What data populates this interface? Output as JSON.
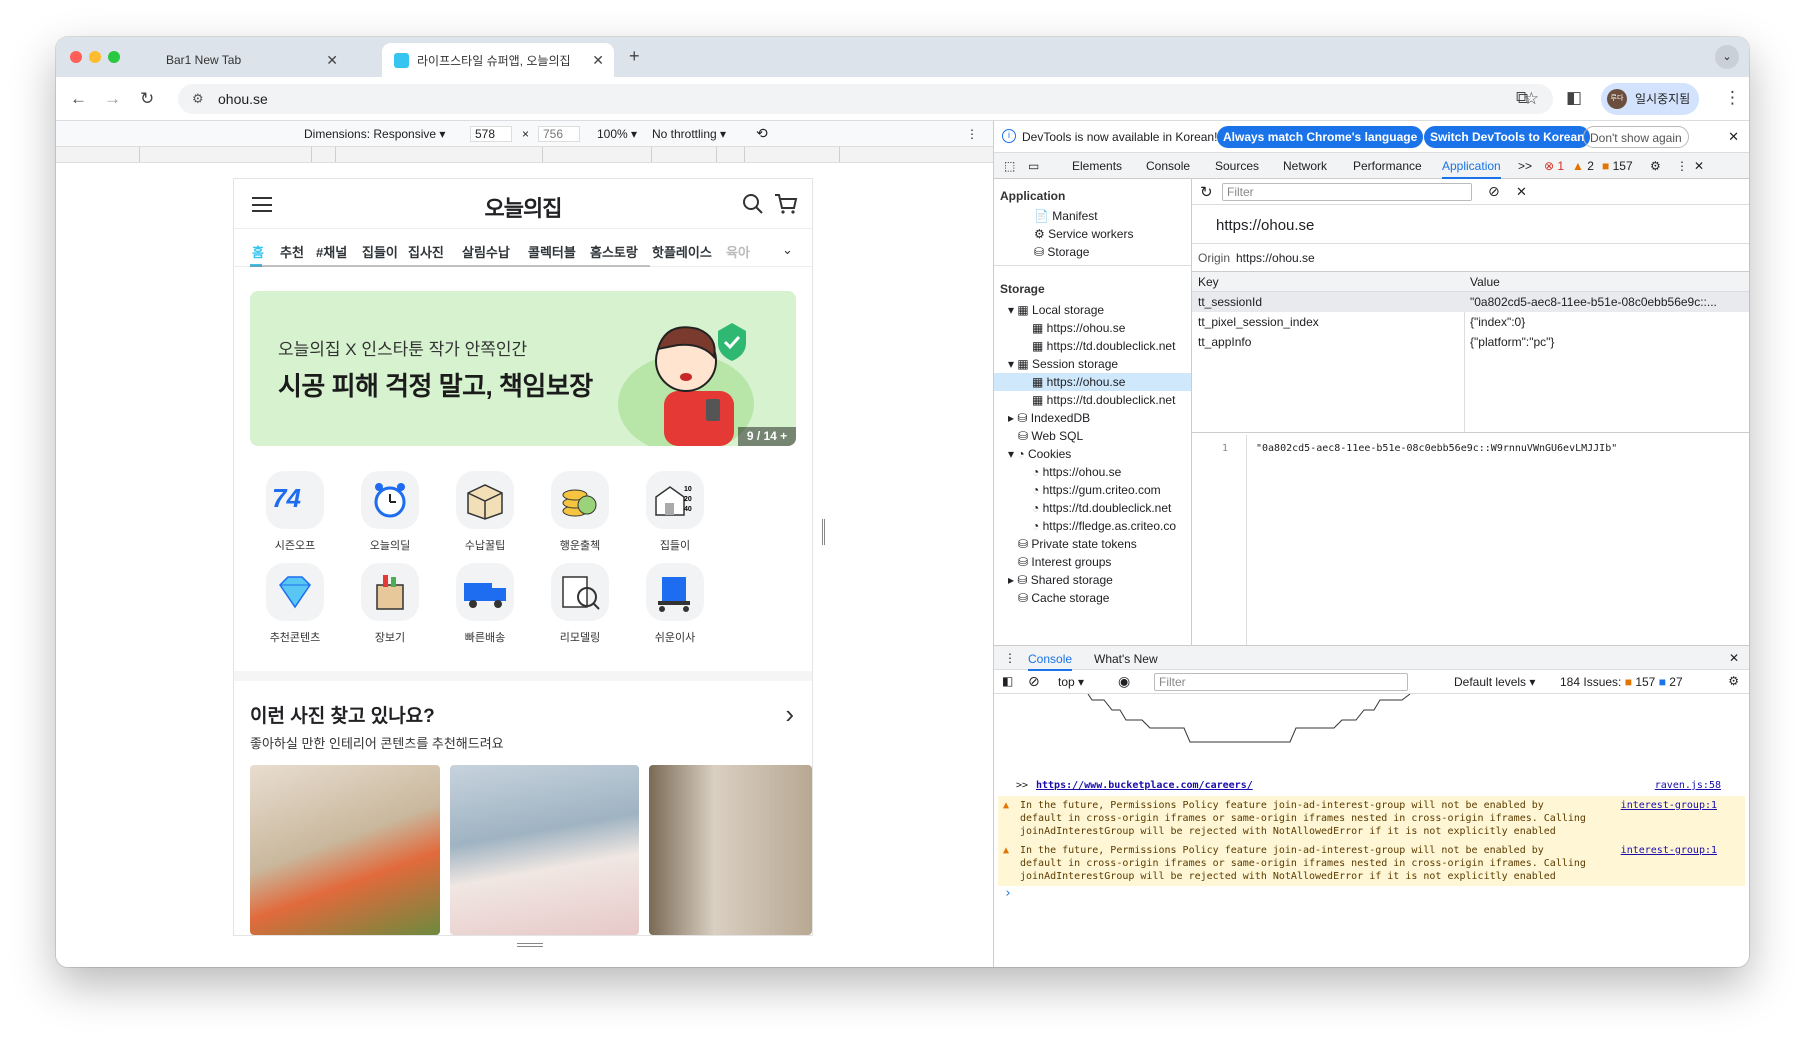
{
  "browser": {
    "tabs": [
      {
        "label": "Bar1 New Tab",
        "active": false
      },
      {
        "label": "라이프스타일 슈퍼앱, 오늘의집",
        "active": true
      }
    ],
    "new_tab": "+",
    "close_glyph": "✕",
    "url": "ohou.se",
    "profile_name": "일시중지됨",
    "profile_initials": "루다"
  },
  "device_toolbar": {
    "dimensions_label": "Dimensions: Responsive",
    "width": "578",
    "times": "×",
    "height": "756",
    "zoom": "100%",
    "throttle": "No throttling"
  },
  "site": {
    "logo": "오늘의집",
    "categories": [
      "홈",
      "추천",
      "#채널",
      "집들이",
      "집사진",
      "살림수납",
      "콜렉터블",
      "홈스토랑",
      "핫플레이스",
      "육아"
    ],
    "banner": {
      "line1": "오늘의집 X 인스타툰 작가 안쪽인간",
      "line2": "시공 피해 걱정 말고, 책임보장",
      "pager": "9 / 14 +"
    },
    "shortcut_badge": "74",
    "shortcut_ticks": [
      "10",
      "20",
      "40"
    ],
    "shortcuts": [
      "시즌오프",
      "오늘의딜",
      "수납꿀팁",
      "행운출첵",
      "집들이",
      "추천콘텐츠",
      "장보기",
      "빠른배송",
      "리모델링",
      "쉬운이사"
    ],
    "section_title": "이런 사진 찾고 있나요?",
    "section_sub": "좋아하실 만한 인테리어 콘텐츠를 추천해드려요"
  },
  "devtools": {
    "info": "DevTools is now available in Korean!",
    "btn_match": "Always match Chrome's language",
    "btn_switch": "Switch DevTools to Korean",
    "btn_dont": "Don't show again",
    "tabs": [
      "Elements",
      "Console",
      "Sources",
      "Network",
      "Performance",
      "Application"
    ],
    "more_tabs": ">>",
    "errors": "1",
    "warnings": "2",
    "issues": "157",
    "filter_placeholder": "Filter",
    "app_section": "Application",
    "app_items": [
      "Manifest",
      "Service workers",
      "Storage"
    ],
    "storage_section": "Storage",
    "tree": [
      {
        "label": "Local storage",
        "level": 1
      },
      {
        "label": "https://ohou.se",
        "level": 2
      },
      {
        "label": "https://td.doubleclick.net",
        "level": 2
      },
      {
        "label": "Session storage",
        "level": 1
      },
      {
        "label": "https://ohou.se",
        "level": 2,
        "selected": true
      },
      {
        "label": "https://td.doubleclick.net",
        "level": 2
      },
      {
        "label": "IndexedDB",
        "level": 1
      },
      {
        "label": "Web SQL",
        "level": 1
      },
      {
        "label": "Cookies",
        "level": 1
      },
      {
        "label": "https://ohou.se",
        "level": 2
      },
      {
        "label": "https://gum.criteo.com",
        "level": 2
      },
      {
        "label": "https://td.doubleclick.net",
        "level": 2
      },
      {
        "label": "https://fledge.as.criteo.co",
        "level": 2
      },
      {
        "label": "Private state tokens",
        "level": 1
      },
      {
        "label": "Interest groups",
        "level": 1
      },
      {
        "label": "Shared storage",
        "level": 1
      },
      {
        "label": "Cache storage",
        "level": 1
      }
    ],
    "origin_title": "https://ohou.se",
    "origin_label": "Origin",
    "origin_value": "https://ohou.se",
    "col_key": "Key",
    "col_value": "Value",
    "rows": [
      {
        "key": "tt_sessionId",
        "value": "\"0a802cd5-aec8-11ee-b51e-08c0ebb56e9c::..."
      },
      {
        "key": "tt_pixel_session_index",
        "value": "{\"index\":0}"
      },
      {
        "key": "tt_appInfo",
        "value": "{\"platform\":\"pc\"}"
      }
    ],
    "preview_line": "1",
    "preview_value": "\"0a802cd5-aec8-11ee-b51e-08c0ebb56e9c::W9rnnuVWnGU6evLMJJIb\""
  },
  "console": {
    "tabs": [
      "Console",
      "What's New"
    ],
    "context": "top",
    "filter_placeholder": "Filter",
    "levels": "Default levels",
    "issues_label": "184 Issues:",
    "issues_warn": "157",
    "issues_info": "27",
    "log_prompt": ">>",
    "log_link": "https://www.bucketplace.com/careers/",
    "log_source": "raven.js:58",
    "warnings": [
      {
        "text": "In the future, Permissions Policy feature join-ad-interest-group will not be enabled by\ndefault in cross-origin iframes or same-origin iframes nested in cross-origin iframes. Calling\njoinAdInterestGroup will be rejected with NotAllowedError if it is not explicitly enabled",
        "source": "interest-group:1"
      },
      {
        "text": "In the future, Permissions Policy feature join-ad-interest-group will not be enabled by\ndefault in cross-origin iframes or same-origin iframes nested in cross-origin iframes. Calling\njoinAdInterestGroup will be rejected with NotAllowedError if it is not explicitly enabled",
        "source": "interest-group:1"
      }
    ],
    "prompt": "›"
  },
  "colors": {
    "accent": "#1a73e8",
    "brand": "#35c5f0",
    "banner_bg": "#d6f2cf",
    "warn_bg": "#fef6d5",
    "error": "#d93025"
  }
}
